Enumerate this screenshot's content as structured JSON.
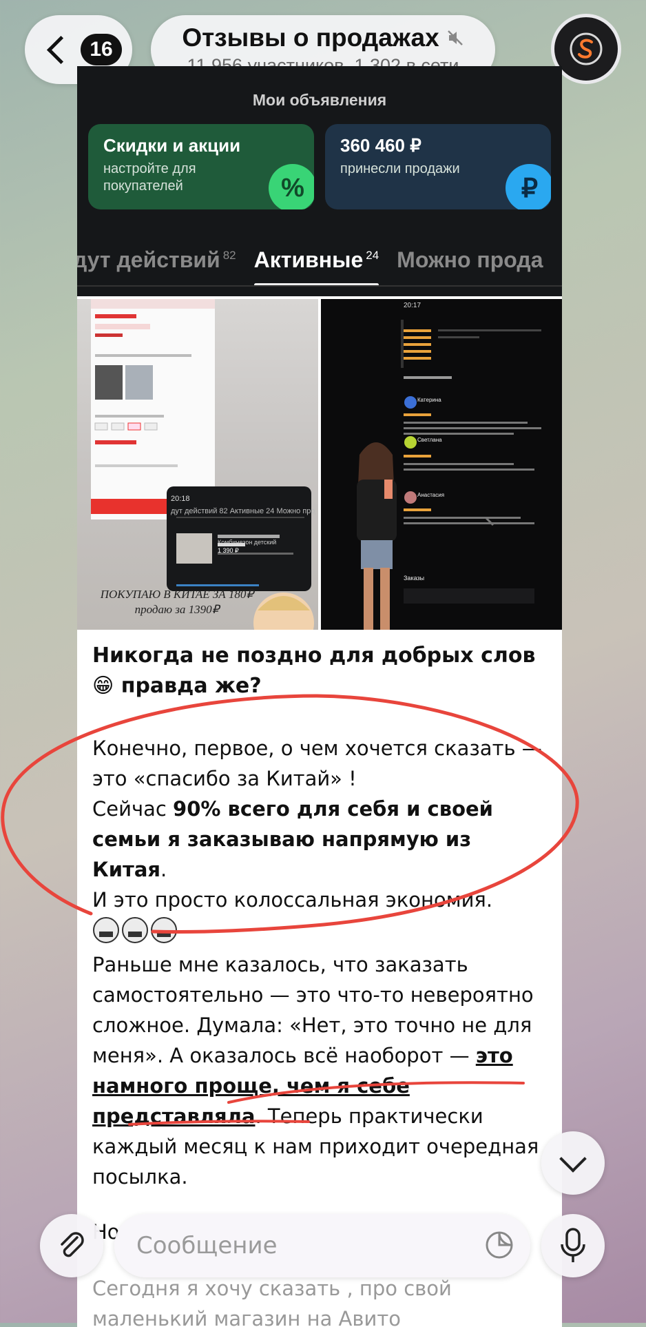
{
  "header": {
    "back_count": "16",
    "title": "Отзывы о продажах",
    "subtitle": "11 956 участников, 1 302 в сети",
    "avatar_letter": "S"
  },
  "panel": {
    "title": "Мои объявления",
    "cards": [
      {
        "title": "Скидки и акции",
        "text": "настройте для покупателей",
        "icon": "%"
      },
      {
        "title": "360 460 ₽",
        "text": "принесли продажи",
        "icon": "₽"
      }
    ],
    "tabs": [
      {
        "label": "дут действий",
        "count": "82"
      },
      {
        "label": "Активные",
        "count": "24"
      },
      {
        "label": "Можно прода",
        "count": ""
      }
    ]
  },
  "photo_left": {
    "caption_line1": "ПОКУПАЮ В КИТАЕ ЗА 180₽",
    "caption_line2": "продаю за 1390₽",
    "inner_card": {
      "time": "20:18",
      "tabs": "дут действий 82   Активные 24   Можно прода",
      "item_name": "Комбинезон детский",
      "item_price": "1 390 ₽"
    }
  },
  "photo_right": {
    "time": "20:17",
    "reviewers": [
      "Катерина",
      "Светлана",
      "Анастасия"
    ],
    "orders_label": "Заказы"
  },
  "message": {
    "heading": "Никогда не поздно для добрых слов 😁 правда же?",
    "p1_a": "Конечно, первое, о чем хочется сказать — это «спасибо за Китай» !",
    "p1_b_plain": "Сейчас ",
    "p1_b_bold": "90% всего для себя и своей семьи я заказываю напрямую из Китая",
    "p1_b_end": ".",
    "p1_c": "И это просто колоссальная экономия.",
    "p2_a": "Раньше мне казалось, что заказать самостоятельно — это что-то невероятно сложное. Думала: «Нет, это точно не для меня». А оказалось всё наоборот — ",
    "p2_bold": "это намного проще, чем я себе представляла",
    "p2_end": ". Теперь практически каждый месяц к нам приходит очередная посылка.",
    "p3_start": "Но",
    "p4": "Сегодня я хочу сказать , про свой маленький магазин на Авито"
  },
  "composer": {
    "placeholder": "Сообщение"
  },
  "colors": {
    "annotation_red": "#e8453c",
    "green_card": "#1f5b3a",
    "blue_card": "#1f3347"
  }
}
